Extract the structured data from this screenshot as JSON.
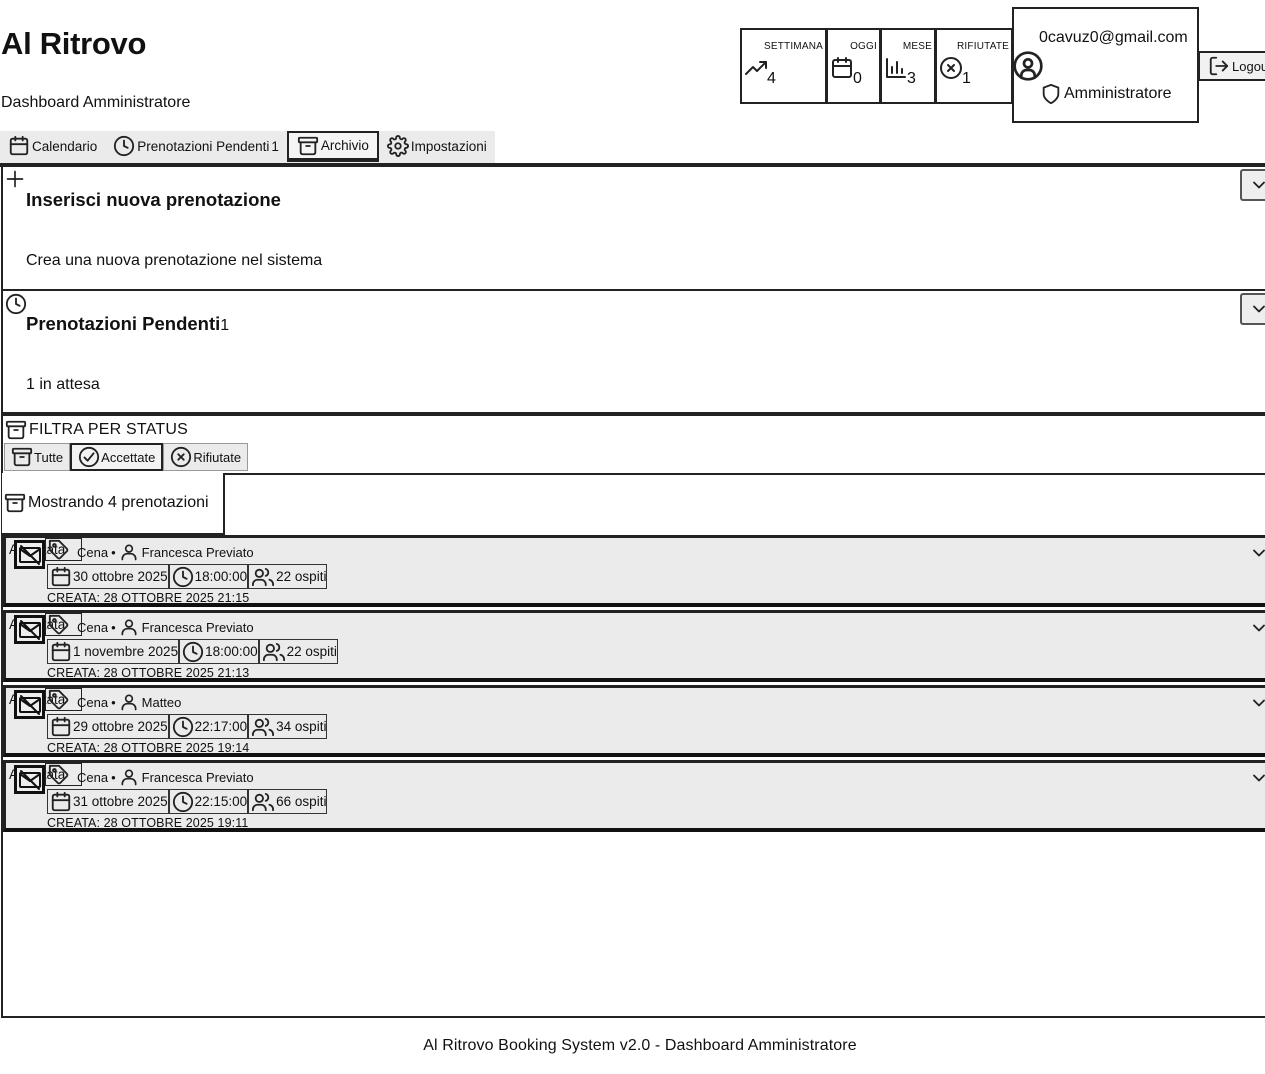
{
  "app": {
    "title": "Al Ritrovo",
    "subtitle": "Dashboard Amministratore"
  },
  "stats": [
    {
      "label": "SETTIMANA",
      "value": "4",
      "icon": "trending-up-icon"
    },
    {
      "label": "OGGI",
      "value": "0",
      "icon": "calendar-icon"
    },
    {
      "label": "MESE",
      "value": "3",
      "icon": "bar-chart-icon"
    },
    {
      "label": "RIFIUTATE",
      "value": "1",
      "icon": "x-circle-icon"
    }
  ],
  "user": {
    "email": "0cavuz0@gmail.com",
    "role": "Amministratore",
    "logout_label": "Logout"
  },
  "tabs": [
    {
      "label": "Calendario",
      "icon": "calendar-icon"
    },
    {
      "label": "Prenotazioni Pendenti",
      "badge": "1",
      "icon": "clock-icon"
    },
    {
      "label": "Archivio",
      "icon": "archive-icon",
      "active": true
    },
    {
      "label": "Impostazioni",
      "icon": "gear-icon"
    }
  ],
  "new_booking": {
    "title": "Inserisci nuova prenotazione",
    "description": "Crea una nuova prenotazione nel sistema"
  },
  "pending": {
    "title": "Prenotazioni Pendenti",
    "badge": "1",
    "description": "1 in attesa"
  },
  "archive": {
    "filter_label": "FILTRA PER STATUS",
    "filters": [
      {
        "label": "Tutte",
        "icon": "archive-icon"
      },
      {
        "label": "Accettate",
        "icon": "check-circle-icon",
        "active": true
      },
      {
        "label": "Rifiutate",
        "icon": "x-circle-icon"
      }
    ],
    "count_text": "Mostrando 4 prenotazioni"
  },
  "bookings": [
    {
      "status": "Accettata",
      "tag_text": "Cena",
      "guest": "Francesca Previato",
      "date": "30 ottobre 2025",
      "time": "18:00:00",
      "guests": "22 ospiti",
      "created": "CREATA: 28 OTTOBRE 2025 21:15"
    },
    {
      "status": "Accettata",
      "tag_text": "Cena",
      "guest": "Francesca Previato",
      "date": "1 novembre 2025",
      "time": "18:00:00",
      "guests": "22 ospiti",
      "created": "CREATA: 28 OTTOBRE 2025 21:13"
    },
    {
      "status": "Accettata",
      "tag_text": "Cena",
      "guest": "Matteo",
      "date": "29 ottobre 2025",
      "time": "22:17:00",
      "guests": "34 ospiti",
      "created": "CREATA: 28 OTTOBRE 2025 19:14"
    },
    {
      "status": "Accettata",
      "tag_text": "Cena",
      "guest": "Francesca Previato",
      "date": "31 ottobre 2025",
      "time": "22:15:00",
      "guests": "66 ospiti",
      "created": "CREATA: 28 OTTOBRE 2025 19:11"
    }
  ],
  "footer": {
    "text": "Al Ritrovo Booking System v2.0 - Dashboard Amministratore"
  }
}
